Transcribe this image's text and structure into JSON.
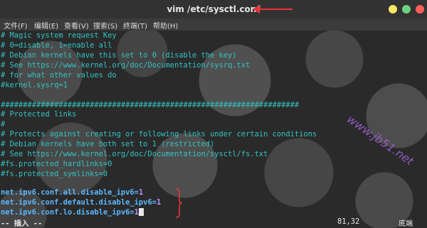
{
  "window": {
    "title": "vim /etc/sysctl.conf"
  },
  "menu": [
    "文件(F)",
    "编辑(E)",
    "查看(V)",
    "搜索(S)",
    "终端(T)",
    "帮助(H)"
  ],
  "lines": [
    "# Magic system request Key",
    "# 0=disable, 1=enable all",
    "# Debian kernels have this set to 0 (disable the key)",
    "# See https://www.kernel.org/doc/Documentation/sysrq.txt",
    "# for what other values do",
    "#kernel.sysrq=1",
    "",
    "###################################################################",
    "# Protected links",
    "#",
    "# Protects against creating or following links under certain conditions",
    "# Debian kernels have both set to 1 (restricted)",
    "# See https://www.kernel.org/doc/Documentation/sysctl/fs.txt",
    "#fs.protected_hardlinks=0",
    "#fs.protected_symlinks=0",
    ""
  ],
  "settings": [
    {
      "key": "net.ipv6.conf.all.disable_ipv6=",
      "value": "1"
    },
    {
      "key": "net.ipv6.conf.default.disable_ipv6=",
      "value": "1"
    },
    {
      "key": "net.ipv6.conf.lo.disable_ipv6=",
      "value": "1"
    }
  ],
  "status": {
    "mode": "-- 插入 --",
    "position": "81,32",
    "location": "底端"
  },
  "watermark": "www.jb51.net",
  "colors": {
    "comment": "#33c2c2",
    "key": "#5bb8ff",
    "value": "#c08dff",
    "annotation": "#e8343a"
  }
}
